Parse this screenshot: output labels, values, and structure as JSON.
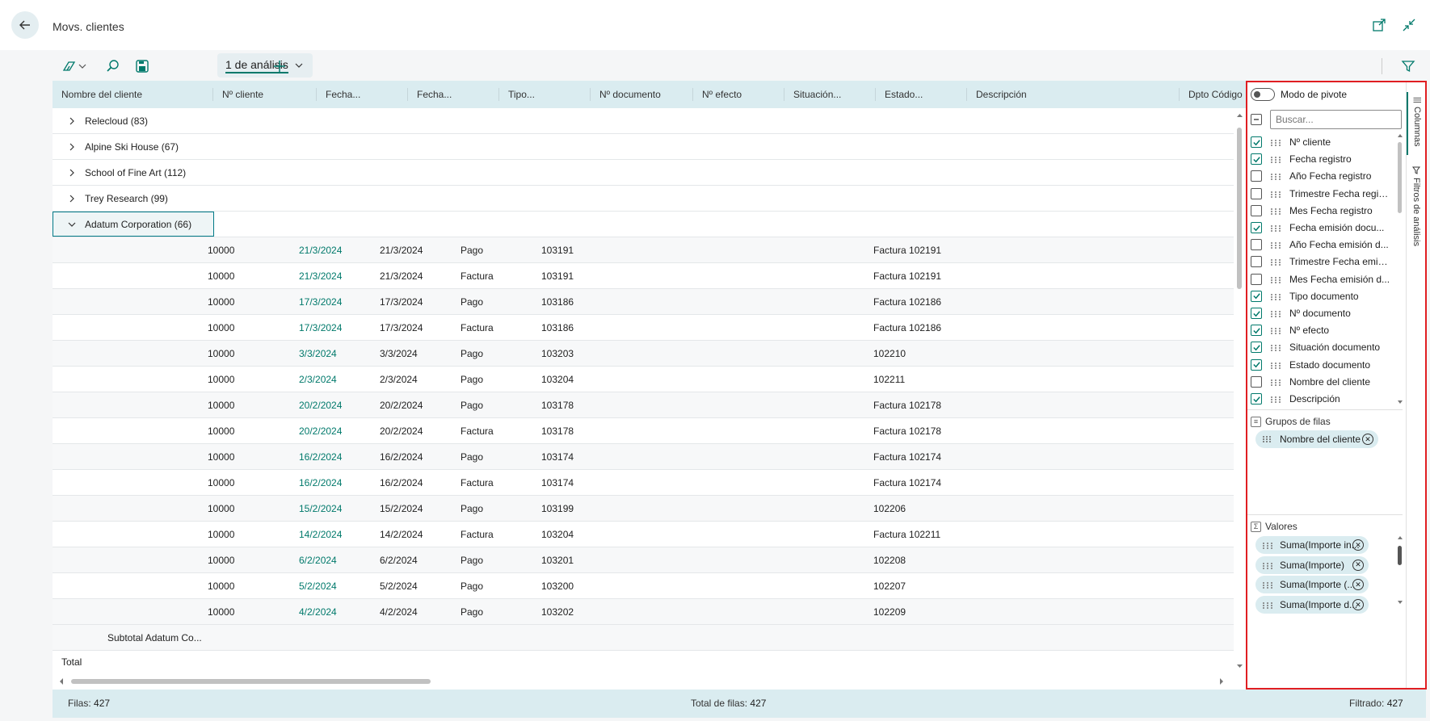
{
  "window": {
    "title": "Movs. clientes"
  },
  "toolbar": {
    "analysis_tab_label": "1 de análisis"
  },
  "columns": [
    "Nombre del cliente",
    "Nº cliente",
    "Fecha...",
    "Fecha...",
    "Tipo...",
    "Nº documento",
    "Nº efecto",
    "Situación...",
    "Estado...",
    "Descripción",
    "Dpto Código"
  ],
  "groups": [
    {
      "label": "Relecloud (83)",
      "expanded": false
    },
    {
      "label": "Alpine Ski House (67)",
      "expanded": false
    },
    {
      "label": "School of Fine Art (112)",
      "expanded": false
    },
    {
      "label": "Trey Research (99)",
      "expanded": false
    },
    {
      "label": "Adatum Corporation (66)",
      "expanded": true
    }
  ],
  "rows": [
    {
      "cliente": "10000",
      "fecha1": "21/3/2024",
      "fecha2": "21/3/2024",
      "tipo": "Pago",
      "doc": "103191",
      "desc": "Factura 102191"
    },
    {
      "cliente": "10000",
      "fecha1": "21/3/2024",
      "fecha2": "21/3/2024",
      "tipo": "Factura",
      "doc": "103191",
      "desc": "Factura 102191"
    },
    {
      "cliente": "10000",
      "fecha1": "17/3/2024",
      "fecha2": "17/3/2024",
      "tipo": "Pago",
      "doc": "103186",
      "desc": "Factura 102186"
    },
    {
      "cliente": "10000",
      "fecha1": "17/3/2024",
      "fecha2": "17/3/2024",
      "tipo": "Factura",
      "doc": "103186",
      "desc": "Factura 102186"
    },
    {
      "cliente": "10000",
      "fecha1": "3/3/2024",
      "fecha2": "3/3/2024",
      "tipo": "Pago",
      "doc": "103203",
      "desc": "102210"
    },
    {
      "cliente": "10000",
      "fecha1": "2/3/2024",
      "fecha2": "2/3/2024",
      "tipo": "Pago",
      "doc": "103204",
      "desc": "102211"
    },
    {
      "cliente": "10000",
      "fecha1": "20/2/2024",
      "fecha2": "20/2/2024",
      "tipo": "Pago",
      "doc": "103178",
      "desc": "Factura 102178"
    },
    {
      "cliente": "10000",
      "fecha1": "20/2/2024",
      "fecha2": "20/2/2024",
      "tipo": "Factura",
      "doc": "103178",
      "desc": "Factura 102178"
    },
    {
      "cliente": "10000",
      "fecha1": "16/2/2024",
      "fecha2": "16/2/2024",
      "tipo": "Pago",
      "doc": "103174",
      "desc": "Factura 102174"
    },
    {
      "cliente": "10000",
      "fecha1": "16/2/2024",
      "fecha2": "16/2/2024",
      "tipo": "Factura",
      "doc": "103174",
      "desc": "Factura 102174"
    },
    {
      "cliente": "10000",
      "fecha1": "15/2/2024",
      "fecha2": "15/2/2024",
      "tipo": "Pago",
      "doc": "103199",
      "desc": "102206"
    },
    {
      "cliente": "10000",
      "fecha1": "14/2/2024",
      "fecha2": "14/2/2024",
      "tipo": "Factura",
      "doc": "103204",
      "desc": "Factura 102211"
    },
    {
      "cliente": "10000",
      "fecha1": "6/2/2024",
      "fecha2": "6/2/2024",
      "tipo": "Pago",
      "doc": "103201",
      "desc": "102208"
    },
    {
      "cliente": "10000",
      "fecha1": "5/2/2024",
      "fecha2": "5/2/2024",
      "tipo": "Pago",
      "doc": "103200",
      "desc": "102207"
    },
    {
      "cliente": "10000",
      "fecha1": "4/2/2024",
      "fecha2": "4/2/2024",
      "tipo": "Pago",
      "doc": "103202",
      "desc": "102209"
    }
  ],
  "subtotal_label": "Subtotal Adatum Co...",
  "total_label": "Total",
  "status": {
    "rows_label": "Filas:",
    "rows_value": "427",
    "total_label": "Total de filas:",
    "total_value": "427",
    "filtered_label": "Filtrado:",
    "filtered_value": "427"
  },
  "panel": {
    "pivot_label": "Modo de pivote",
    "search_placeholder": "Buscar...",
    "columns": [
      {
        "label": "Nº cliente",
        "checked": true
      },
      {
        "label": "Fecha registro",
        "checked": true
      },
      {
        "label": "Año Fecha registro",
        "checked": false
      },
      {
        "label": "Trimestre Fecha regis...",
        "checked": false
      },
      {
        "label": "Mes Fecha registro",
        "checked": false
      },
      {
        "label": "Fecha emisión docu...",
        "checked": true
      },
      {
        "label": "Año Fecha emisión d...",
        "checked": false
      },
      {
        "label": "Trimestre Fecha emisi...",
        "checked": false
      },
      {
        "label": "Mes Fecha emisión d...",
        "checked": false
      },
      {
        "label": "Tipo documento",
        "checked": true
      },
      {
        "label": "Nº documento",
        "checked": true
      },
      {
        "label": "Nº efecto",
        "checked": true
      },
      {
        "label": "Situación documento",
        "checked": true
      },
      {
        "label": "Estado documento",
        "checked": true
      },
      {
        "label": "Nombre del cliente",
        "checked": false
      },
      {
        "label": "Descripción",
        "checked": true
      }
    ],
    "row_groups_label": "Grupos de filas",
    "row_groups": [
      "Nombre del cliente"
    ],
    "values_label": "Valores",
    "values": [
      "Suma(Importe in...",
      "Suma(Importe)",
      "Suma(Importe (...",
      "Suma(Importe d..."
    ],
    "tab_columns": "Columnas",
    "tab_filters": "Filtros de análisis"
  },
  "colors": {
    "accent": "#00796b",
    "header_bg": "#daecf0",
    "highlight_border": "#e01e22"
  }
}
